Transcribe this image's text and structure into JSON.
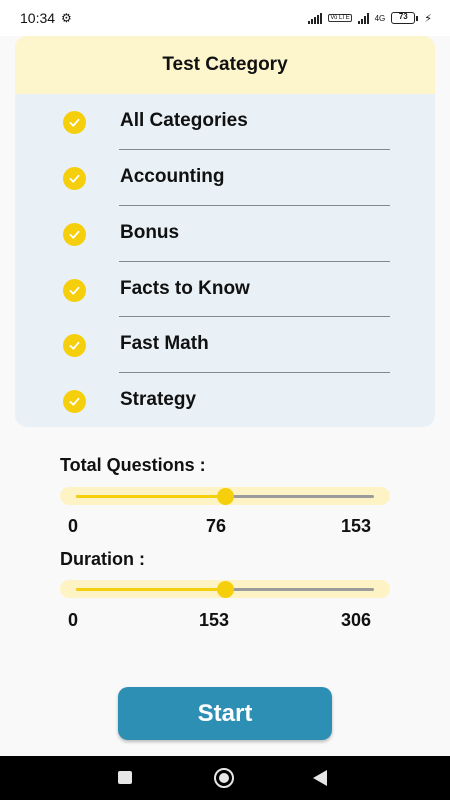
{
  "status_bar": {
    "time": "10:34",
    "battery_level": "73",
    "network": "4G",
    "volte": "Vo LTE"
  },
  "card": {
    "title": "Test Category",
    "categories": [
      {
        "label": "All Categories",
        "checked": true
      },
      {
        "label": "Accounting",
        "checked": true
      },
      {
        "label": "Bonus",
        "checked": true
      },
      {
        "label": "Facts to Know",
        "checked": true
      },
      {
        "label": "Fast Math",
        "checked": true
      },
      {
        "label": "Strategy",
        "checked": true
      }
    ]
  },
  "total_questions": {
    "label": "Total Questions :",
    "min": "0",
    "value": "76",
    "max": "153",
    "fraction": 0.5
  },
  "duration": {
    "label": "Duration :",
    "min": "0",
    "value": "153",
    "max": "306",
    "fraction": 0.5
  },
  "start_button": {
    "label": "Start"
  },
  "colors": {
    "accent_yellow": "#f6cf0c",
    "header_bg": "#fdf6cd",
    "card_bg": "#e9f1f7",
    "button_blue": "#2e8fb5"
  },
  "icons": {
    "check": "check-circle-icon",
    "nav_recent": "recent-apps-icon",
    "nav_home": "home-icon",
    "nav_back": "back-icon"
  }
}
